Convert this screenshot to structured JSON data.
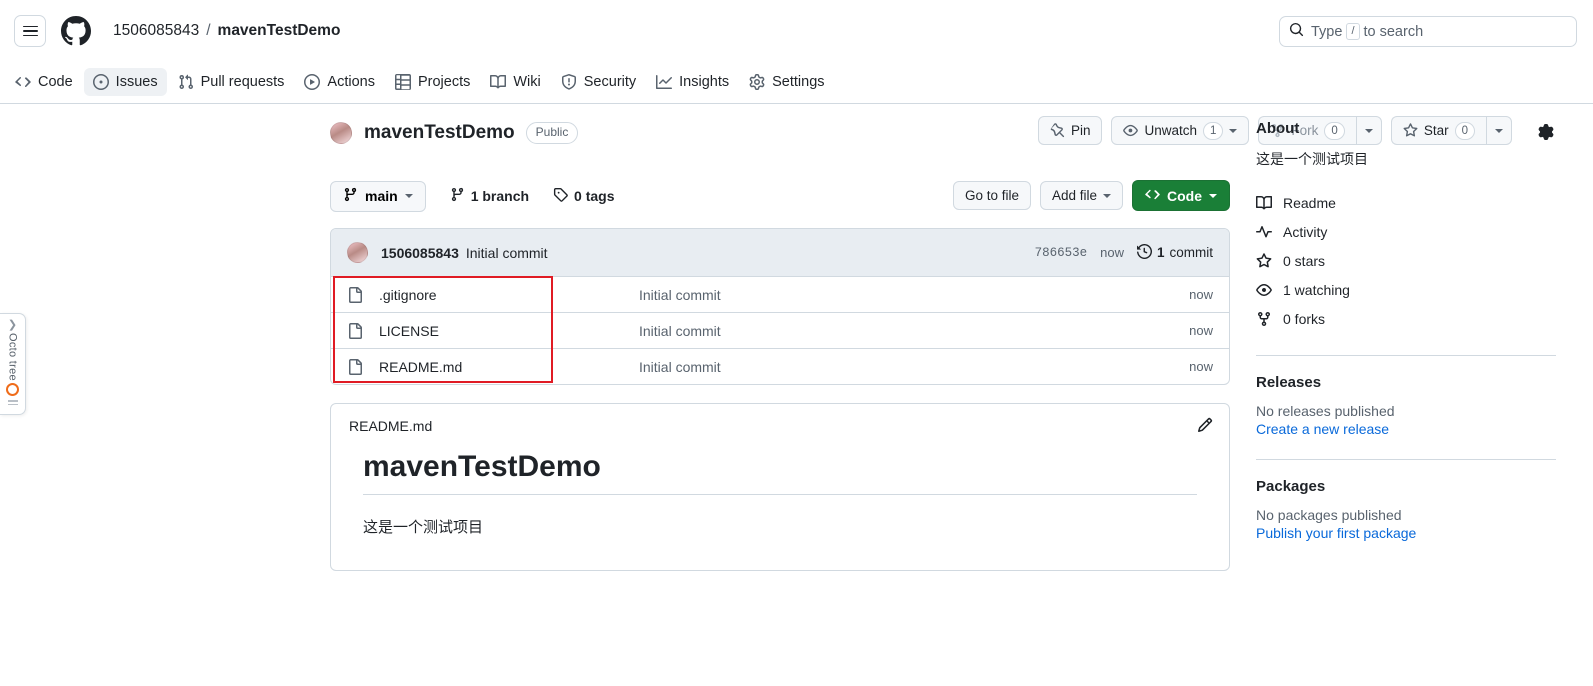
{
  "header": {
    "menu_icon": "hamburger-icon",
    "logo_icon": "github-logo-icon",
    "owner": "1506085843",
    "separator": "/",
    "repo": "mavenTestDemo",
    "search": {
      "icon": "search-icon",
      "placeholder_prefix": "Type",
      "key_hint": "/",
      "placeholder_suffix": "to search"
    }
  },
  "nav": {
    "tabs": [
      {
        "label": "Code",
        "icon": "code-icon"
      },
      {
        "label": "Issues",
        "icon": "issue-opened-icon"
      },
      {
        "label": "Pull requests",
        "icon": "git-pull-request-icon"
      },
      {
        "label": "Actions",
        "icon": "play-icon"
      },
      {
        "label": "Projects",
        "icon": "table-icon"
      },
      {
        "label": "Wiki",
        "icon": "book-icon"
      },
      {
        "label": "Security",
        "icon": "shield-icon"
      },
      {
        "label": "Insights",
        "icon": "graph-icon"
      },
      {
        "label": "Settings",
        "icon": "gear-icon"
      }
    ]
  },
  "repo": {
    "avatar": "owner-avatar",
    "name": "mavenTestDemo",
    "visibility": "Public",
    "actions": {
      "pin": {
        "label": "Pin",
        "icon": "pin-icon"
      },
      "watch": {
        "label": "Unwatch",
        "count": "1",
        "icon": "eye-icon"
      },
      "fork": {
        "label": "Fork",
        "count": "0",
        "icon": "repo-forked-icon"
      },
      "star": {
        "label": "Star",
        "count": "0",
        "icon": "star-icon"
      }
    }
  },
  "toolbar": {
    "branch": {
      "label": "main",
      "icon": "git-branch-icon"
    },
    "branch_count": "1 branch",
    "tag_count": "0 tags",
    "branches_icon": "git-branch-icon",
    "tags_icon": "tag-icon",
    "go_to_file": "Go to file",
    "add_file": "Add file",
    "code": "Code",
    "code_icon": "code-icon"
  },
  "commit_bar": {
    "avatar": "author-avatar",
    "author": "1506085843",
    "message": "Initial commit",
    "sha": "786653e",
    "time": "now",
    "history_icon": "history-icon",
    "commit_count": "1",
    "commit_count_label": "commit"
  },
  "files": {
    "icon": "file-icon",
    "rows": [
      {
        "name": ".gitignore",
        "message": "Initial commit",
        "time": "now"
      },
      {
        "name": "LICENSE",
        "message": "Initial commit",
        "time": "now"
      },
      {
        "name": "README.md",
        "message": "Initial commit",
        "time": "now"
      }
    ],
    "annotation_color": "#e01b24"
  },
  "readme": {
    "filename": "README.md",
    "edit_icon": "pencil-icon",
    "heading": "mavenTestDemo",
    "body": "这是一个测试项目"
  },
  "sidebar": {
    "about": {
      "title": "About",
      "gear_icon": "gear-icon",
      "description": "这是一个测试项目",
      "items": [
        {
          "label": "Readme",
          "icon": "book-icon"
        },
        {
          "label": "Activity",
          "icon": "pulse-icon"
        },
        {
          "label": "0 stars",
          "icon": "star-icon"
        },
        {
          "label": "1 watching",
          "icon": "eye-icon"
        },
        {
          "label": "0 forks",
          "icon": "repo-forked-icon"
        }
      ]
    },
    "releases": {
      "title": "Releases",
      "empty": "No releases published",
      "link": "Create a new release"
    },
    "packages": {
      "title": "Packages",
      "empty": "No packages published",
      "link": "Publish your first package"
    }
  },
  "octotree": {
    "label": "Octo tree",
    "chevron_icon": "chevron-right-icon",
    "logo_icon": "octotree-logo-icon",
    "grip_icon": "drag-handle-icon",
    "accent": "#ef6c1a"
  }
}
